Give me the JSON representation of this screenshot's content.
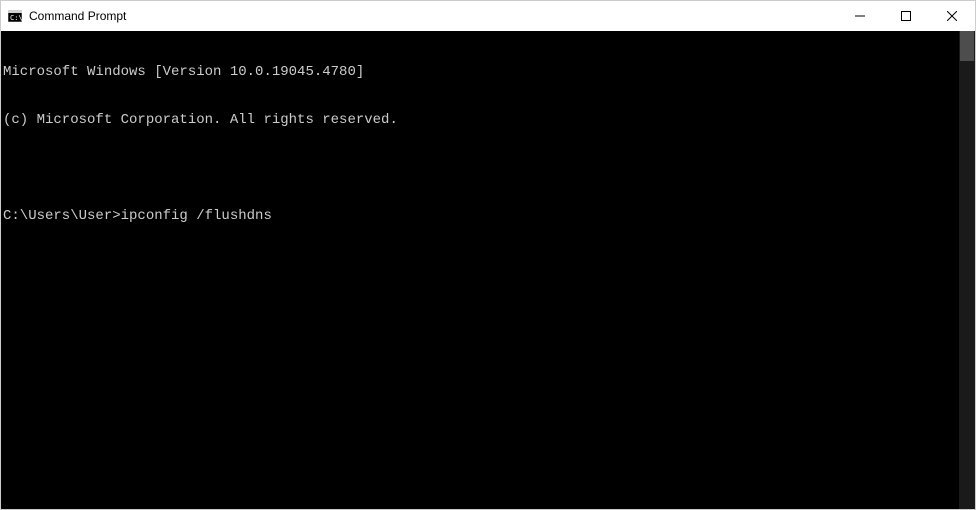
{
  "window": {
    "title": "Command Prompt"
  },
  "terminal": {
    "lines": [
      "Microsoft Windows [Version 10.0.19045.4780]",
      "(c) Microsoft Corporation. All rights reserved.",
      "",
      "C:\\Users\\User>ipconfig /flushdns"
    ]
  }
}
